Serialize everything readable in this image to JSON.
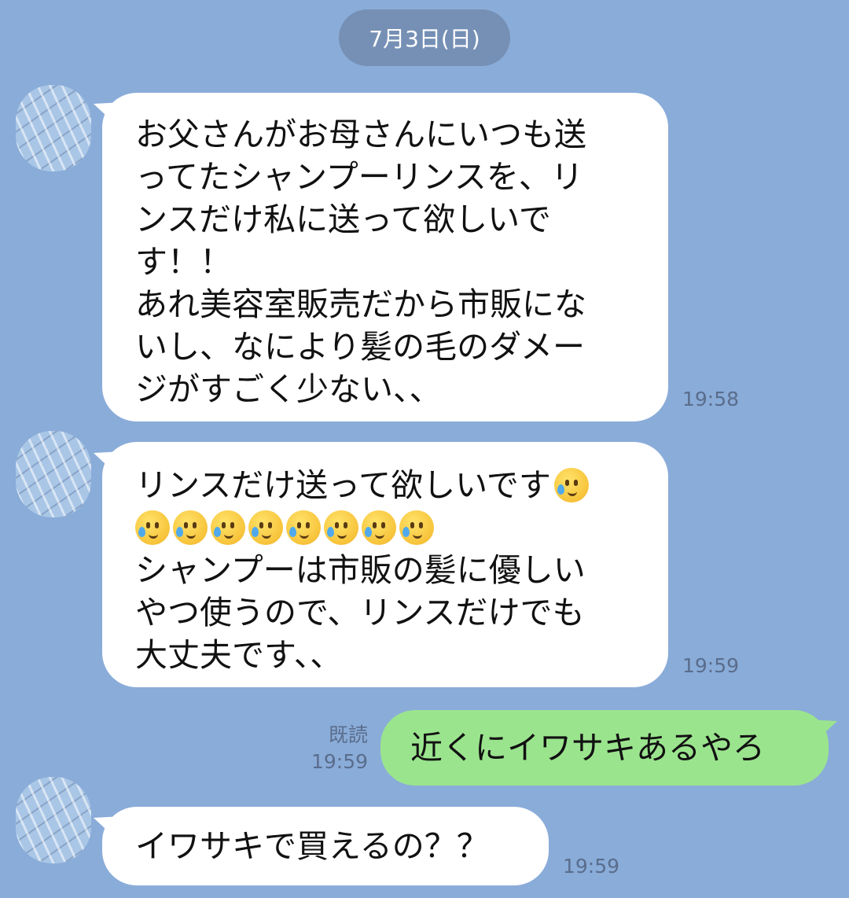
{
  "date_divider": "7月3日(日)",
  "messages": [
    {
      "lines": [
        "お父さんがお母さんにいつも送",
        "ってたシャンプーリンスを、リ",
        "ンスだけ私に送って欲しいで",
        "す！！",
        "あれ美容室販売だから市販にな",
        "いし、なにより髪の毛のダメー",
        "ジがすごく少ない、、"
      ],
      "time": "19:58"
    },
    {
      "line1": "リンスだけ送って欲しいです",
      "emoji": "smiling-face-with-tear",
      "emoji_row_count": 8,
      "lines": [
        "シャンプーは市販の髪に優しい",
        "やつ使うので、リンスだけでも",
        "大丈夫です、、"
      ],
      "time": "19:59"
    },
    {
      "text": "近くにイワサキあるやろ",
      "read_label": "既読",
      "time": "19:59"
    },
    {
      "text": "イワサキで買えるの？？",
      "time": "19:59"
    }
  ],
  "colors": {
    "background": "#8aacd9",
    "incoming_bubble": "#ffffff",
    "outgoing_bubble": "#9be48e",
    "date_pill": "#7690b5"
  }
}
